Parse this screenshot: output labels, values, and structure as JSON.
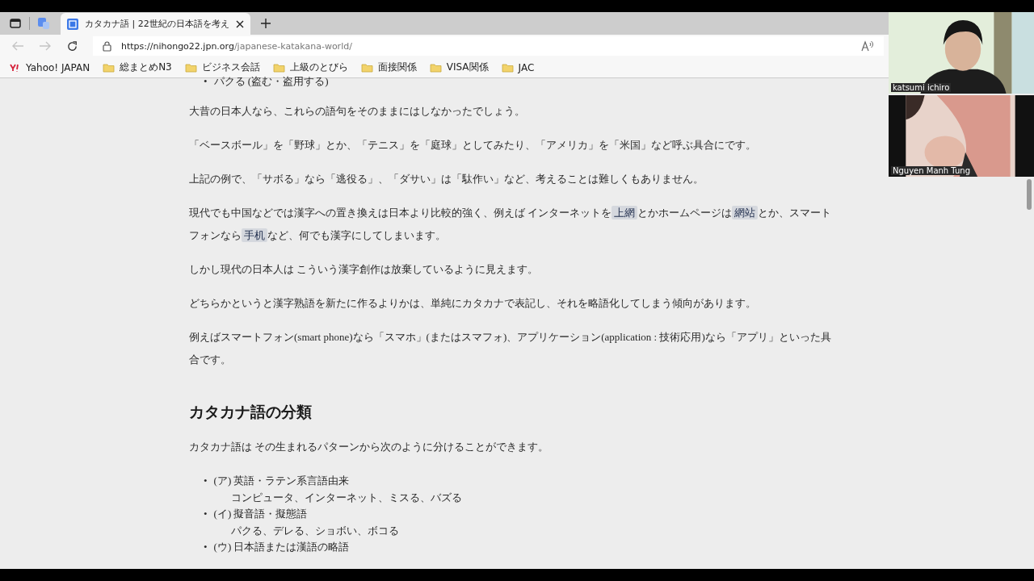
{
  "browser": {
    "tabs": [
      {
        "kind": "vertical-tabs",
        "selected": false
      },
      {
        "kind": "translate",
        "selected": false
      },
      {
        "kind": "page",
        "title": "カタカナ語 | 22世紀の日本語を考え",
        "selected": true
      }
    ],
    "address": {
      "host": "https://nihongo22.jpn.org",
      "path": "/japanese-katakana-world/"
    },
    "bookmarks": [
      {
        "kind": "yahoo",
        "label": "Yahoo! JAPAN"
      },
      {
        "kind": "folder",
        "label": "総まとめN3"
      },
      {
        "kind": "folder",
        "label": "ビジネス会話"
      },
      {
        "kind": "folder",
        "label": "上級のとびら"
      },
      {
        "kind": "folder",
        "label": "面接関係"
      },
      {
        "kind": "folder",
        "label": "VISA関係"
      },
      {
        "kind": "folder",
        "label": "JAC"
      }
    ]
  },
  "article": [
    {
      "kind": "bullet",
      "marker": "•",
      "text": "パクる (盗む・盗用する)"
    },
    {
      "kind": "p",
      "parts": [
        {
          "text": "大昔の日本人なら、これらの語句をそのままにはしなかったでしょう。"
        }
      ]
    },
    {
      "kind": "p",
      "parts": [
        {
          "text": "「ベースボール」を「野球」とか、「テニス」を「庭球」としてみたり、「アメリカ」を「米国」など呼ぶ具合にです。"
        }
      ]
    },
    {
      "kind": "p",
      "parts": [
        {
          "text": "上記の例で、「サボる」なら「逃役る」、「ダサい」は「駄作い」など、考えることは難しくもありません。"
        }
      ]
    },
    {
      "kind": "p",
      "parts": [
        {
          "text": "現代でも中国などでは漢字への置き換えは日本より比較的強く、例えば インターネットを"
        },
        {
          "text": "上網",
          "mark": true
        },
        {
          "text": "とかホームページは"
        },
        {
          "text": "網站",
          "mark": true
        },
        {
          "text": "とか、スマートフォンなら"
        },
        {
          "text": "手机",
          "mark": true
        },
        {
          "text": "など、何でも漢字にしてしまいます。"
        }
      ]
    },
    {
      "kind": "p",
      "parts": [
        {
          "text": "しかし現代の日本人は こういう漢字創作は放棄しているように見えます。"
        }
      ]
    },
    {
      "kind": "p",
      "parts": [
        {
          "text": "どちらかというと漢字熟語を新たに作るよりかは、単純にカタカナで表記し、それを略語化してしまう傾向があります。"
        }
      ]
    },
    {
      "kind": "p",
      "parts": [
        {
          "text": "例えばスマートフォン(smart phone)なら「スマホ」(またはスマフォ)、アプリケーション(application : 技術応用)なら「アプリ」といった具合です。"
        }
      ]
    },
    {
      "kind": "h2",
      "text": "カタカナ語の分類"
    },
    {
      "kind": "p",
      "parts": [
        {
          "text": "カタカナ語は その生まれるパターンから次のように分けることができます。"
        }
      ]
    },
    {
      "kind": "list",
      "items": [
        {
          "marker": "•",
          "title": "(ア) 英語・ラテン系言語由来",
          "detail": "コンピュータ、インターネット、ミスる、バズる"
        },
        {
          "marker": "•",
          "title": "(イ) 擬音語・擬態語",
          "detail": "パクる、デレる、ショボい、ボコる"
        },
        {
          "marker": "•",
          "title": "(ウ) 日本語または漢語の略語"
        }
      ]
    }
  ],
  "participants": [
    {
      "name": "katsumi ichiro"
    },
    {
      "name": "Nguyen Manh Tung"
    }
  ]
}
